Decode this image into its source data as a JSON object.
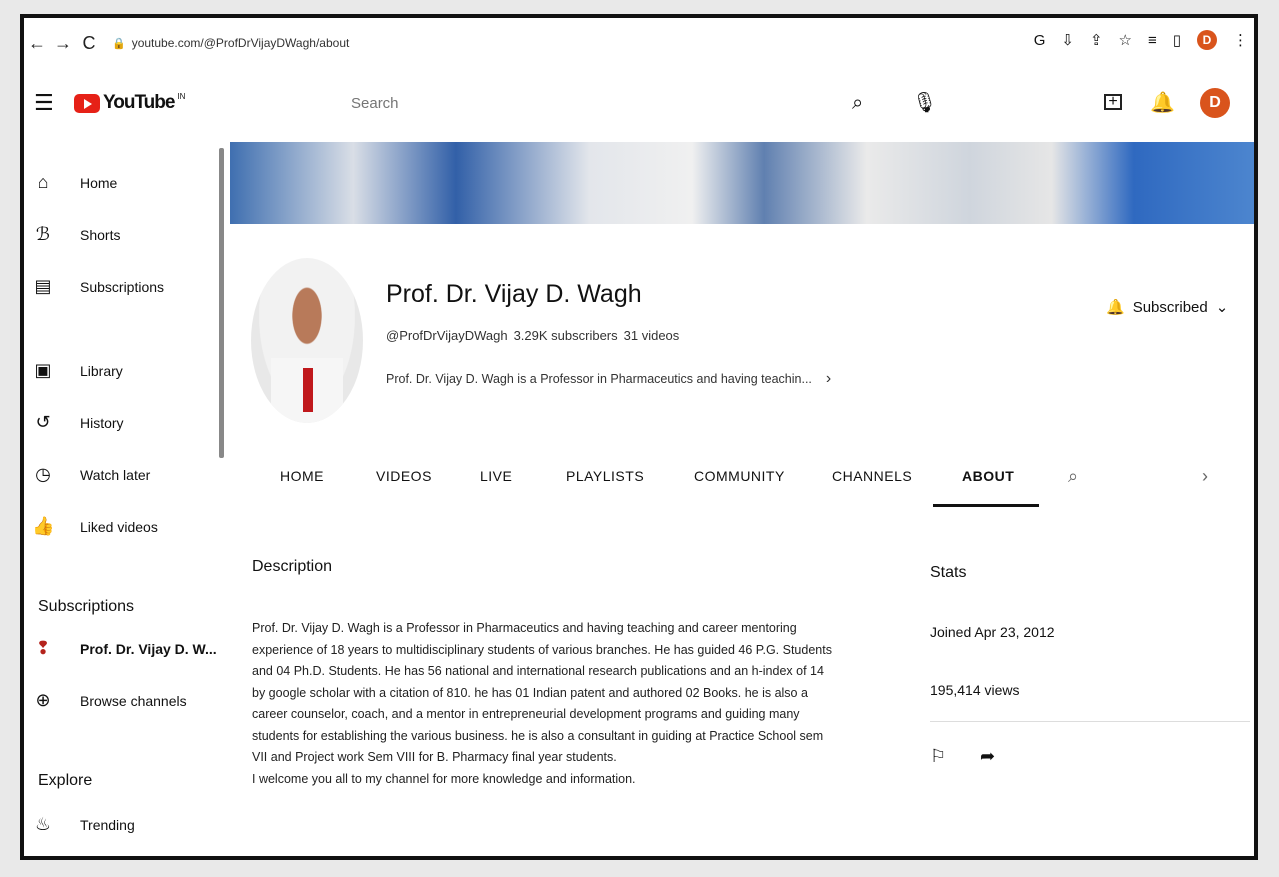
{
  "browser": {
    "url": "youtube.com/@ProfDrVijayDWagh/about",
    "profile_initial": "D"
  },
  "header": {
    "logo_text": "YouTube",
    "logo_sup": "IN",
    "search_placeholder": "Search",
    "avatar_initial": "D"
  },
  "sidebar": {
    "items": [
      {
        "label": "Home",
        "icon": "home-icon"
      },
      {
        "label": "Shorts",
        "icon": "shorts-icon"
      },
      {
        "label": "Subscriptions",
        "icon": "subscriptions-icon"
      },
      {
        "label": "Library",
        "icon": "library-icon"
      },
      {
        "label": "History",
        "icon": "history-icon"
      },
      {
        "label": "Watch later",
        "icon": "watch-later-icon"
      },
      {
        "label": "Liked videos",
        "icon": "liked-icon"
      }
    ],
    "subscriptions_heading": "Subscriptions",
    "subscription_channel": "Prof. Dr. Vijay D. W...",
    "browse_channels": "Browse channels",
    "explore_heading": "Explore",
    "trending": "Trending"
  },
  "channel": {
    "name": "Prof. Dr. Vijay D. Wagh",
    "handle": "@ProfDrVijayDWagh",
    "subscribers": "3.29K subscribers",
    "videos": "31 videos",
    "short_description": "Prof. Dr. Vijay D. Wagh is a Professor in Pharmaceutics and having teachin...",
    "subscribed_label": "Subscribed"
  },
  "tabs": [
    "HOME",
    "VIDEOS",
    "LIVE",
    "PLAYLISTS",
    "COMMUNITY",
    "CHANNELS",
    "ABOUT"
  ],
  "about": {
    "description_heading": "Description",
    "description": "Prof. Dr. Vijay D. Wagh is a Professor in Pharmaceutics and having teaching and career mentoring\nexperience of 18 years to multidisciplinary students of various branches. He has guided 46 P.G. Students\nand 04 Ph.D. Students. He has 56 national and international research publications and an h-index of 14\nby google scholar with a citation of 810. he has 01 Indian patent and authored 02 Books. he is also a\ncareer counselor, coach, and a mentor in entrepreneurial development programs and guiding many\nstudents for establishing the various business. he is also a consultant in guiding at Practice School sem\nVII and Project work Sem VIII for B. Pharmacy final year students.\nI welcome you all to my channel for more knowledge and information.",
    "stats_heading": "Stats",
    "joined": "Joined Apr 23, 2012",
    "views": "195,414 views"
  }
}
